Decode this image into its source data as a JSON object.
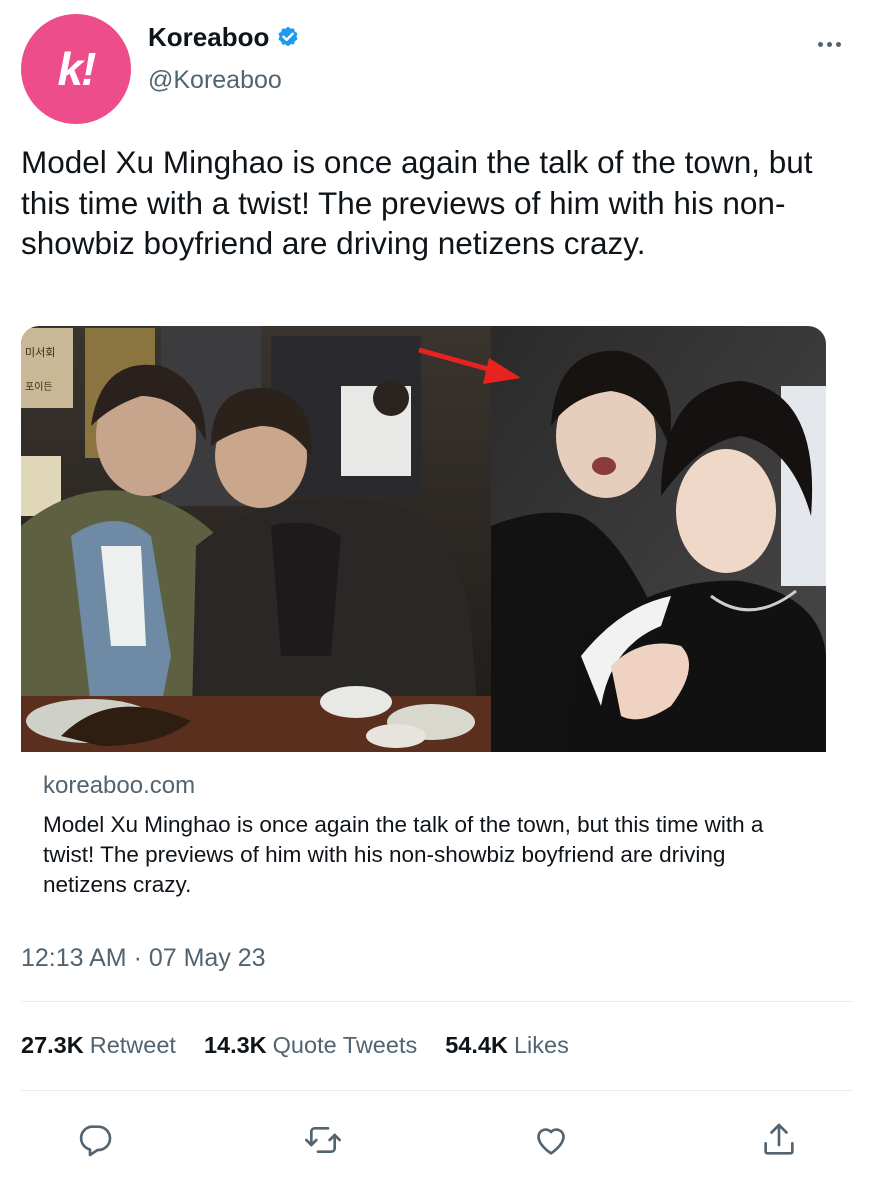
{
  "account": {
    "display_name": "Koreaboo",
    "handle": "@Koreaboo",
    "avatar_glyph": "k!",
    "avatar_color": "#ee4d8b",
    "verified_color": "#1d9bf0"
  },
  "tweet": {
    "text": "Model Xu Minghao is once again the talk of the town, but this time with a twist! The previews of him with his non-showbiz boyfriend are driving netizens crazy.",
    "timestamp": "12:13 AM · 07 May 23"
  },
  "card": {
    "domain": "koreaboo.com",
    "title": "Model Xu Minghao is once again the talk of the town, but this time with a twist! The previews of him with his non-showbiz boyfriend are driving netizens crazy.",
    "sign_text": "미서회",
    "sign_text_2": "포이든"
  },
  "stats": {
    "retweets_count": "27.3K",
    "retweets_label": "Retweet",
    "quotes_count": "14.3K",
    "quotes_label": "Quote Tweets",
    "likes_count": "54.4K",
    "likes_label": "Likes"
  },
  "icons": {
    "reply": "reply-icon",
    "retweet": "retweet-icon",
    "like": "heart-icon",
    "share": "share-icon",
    "more": "more-icon"
  }
}
